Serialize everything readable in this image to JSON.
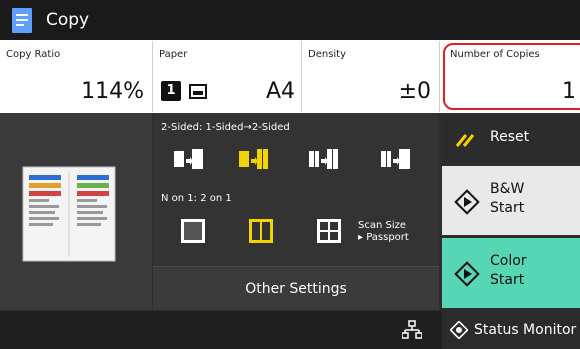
{
  "header": {
    "title": "Copy",
    "icon": "copy-app-icon"
  },
  "settings": {
    "copy_ratio": {
      "label": "Copy Ratio",
      "value": "114%"
    },
    "paper": {
      "label": "Paper",
      "tray_number": "1",
      "size": "A4",
      "tray_icon": "paper-tray-icon"
    },
    "density": {
      "label": "Density",
      "value": "±0"
    },
    "copies": {
      "label": "Number of Copies",
      "value": "1"
    }
  },
  "duplex": {
    "label": "2-Sided: 1-Sided→2-Sided",
    "options": [
      "1-sided-to-1-sided-icon",
      "1-sided-to-2-sided-icon",
      "2-sided-to-2-sided-icon",
      "2-sided-to-1-sided-icon"
    ],
    "selected_index": 1
  },
  "nup": {
    "label": "N on 1: 2 on 1",
    "options": [
      "n-on-1-off-icon",
      "2-on-1-icon",
      "4-on-1-icon"
    ],
    "selected_index": 1
  },
  "scan_size": {
    "line1": "Scan Size",
    "line2": "▸ Passport"
  },
  "other_settings": "Other Settings",
  "actions": {
    "reset": "Reset",
    "bw_start_line1": "B&W",
    "bw_start_line2": "Start",
    "color_start_line1": "Color",
    "color_start_line2": "Start"
  },
  "bottom": {
    "network_icon": "network-icon",
    "status_monitor": "Status Monitor"
  },
  "colors": {
    "topbar": "#1a1a1a",
    "highlight": "#e02020",
    "selected_option": "#f2d200",
    "color_start": "#57d6b5",
    "bw_start": "#e9e9e9"
  }
}
